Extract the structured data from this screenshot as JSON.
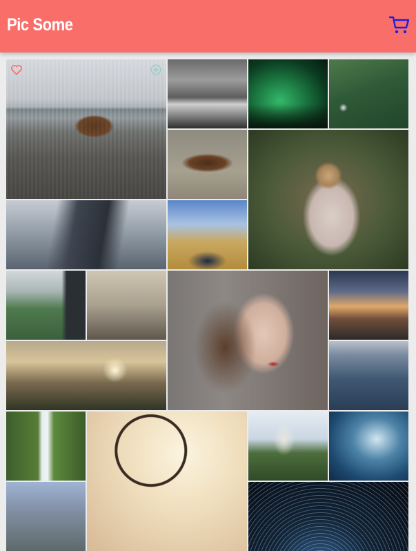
{
  "header": {
    "title": "Pic Some",
    "cart_icon": "cart-icon",
    "background": "#fa6e6a"
  },
  "photos": [
    {
      "name": "photo-bear",
      "icons": [
        "heart-icon",
        "add-to-cart-icon"
      ]
    },
    {
      "name": "photo-misty-forest"
    },
    {
      "name": "photo-aurora"
    },
    {
      "name": "photo-green-pines"
    },
    {
      "name": "photo-eagle"
    },
    {
      "name": "photo-pug-blanket"
    },
    {
      "name": "photo-skyscraper"
    },
    {
      "name": "photo-feet-field"
    },
    {
      "name": "photo-city-park"
    },
    {
      "name": "photo-dead-trees"
    },
    {
      "name": "photo-woman-portrait"
    },
    {
      "name": "photo-railway-sunset"
    },
    {
      "name": "photo-valley-sunset"
    },
    {
      "name": "photo-sea-waves"
    },
    {
      "name": "photo-waterfall"
    },
    {
      "name": "photo-dreamcatcher"
    },
    {
      "name": "photo-castle"
    },
    {
      "name": "photo-wave"
    },
    {
      "name": "photo-mountain-lake"
    },
    {
      "name": "photo-star-trails"
    }
  ]
}
